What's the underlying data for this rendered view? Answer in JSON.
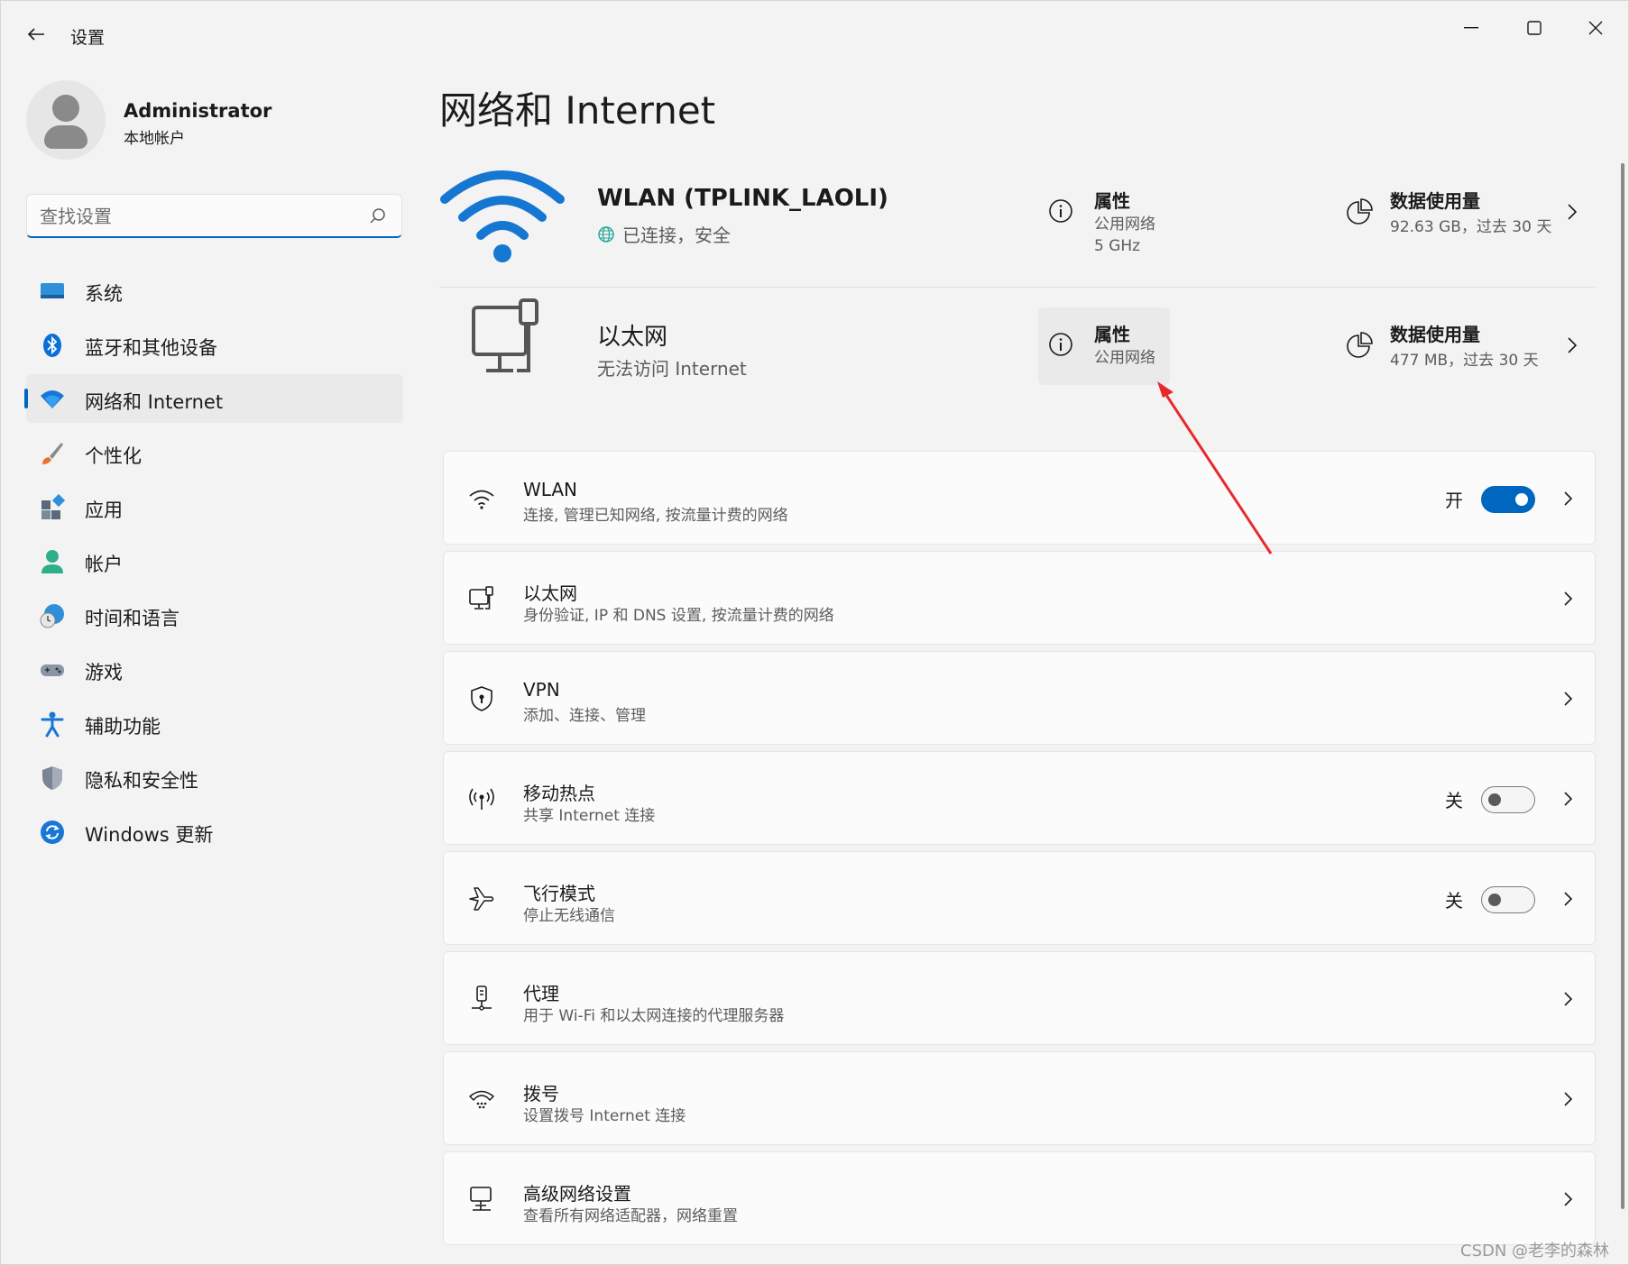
{
  "window": {
    "title": "设置"
  },
  "profile": {
    "name": "Administrator",
    "account_type": "本地帐户"
  },
  "search": {
    "placeholder": "查找设置"
  },
  "nav": [
    {
      "label": "系统",
      "icon": "display-icon"
    },
    {
      "label": "蓝牙和其他设备",
      "icon": "bluetooth-icon"
    },
    {
      "label": "网络和 Internet",
      "icon": "wifi-icon",
      "active": true
    },
    {
      "label": "个性化",
      "icon": "brush-icon"
    },
    {
      "label": "应用",
      "icon": "apps-icon"
    },
    {
      "label": "帐户",
      "icon": "person-icon"
    },
    {
      "label": "时间和语言",
      "icon": "clock-globe-icon"
    },
    {
      "label": "游戏",
      "icon": "gamepad-icon"
    },
    {
      "label": "辅助功能",
      "icon": "accessibility-icon"
    },
    {
      "label": "隐私和安全性",
      "icon": "shield-icon"
    },
    {
      "label": "Windows 更新",
      "icon": "update-icon"
    }
  ],
  "page": {
    "title": "网络和 Internet"
  },
  "connections": [
    {
      "name": "WLAN (TPLINK_LAOLI)",
      "status": "已连接，安全",
      "properties_title": "属性",
      "properties_network": "公用网络",
      "properties_band": "5 GHz",
      "usage_title": "数据使用量",
      "usage_value": "92.63 GB，过去 30 天"
    },
    {
      "name": "以太网",
      "status": "无法访问 Internet",
      "properties_title": "属性",
      "properties_network": "公用网络",
      "usage_title": "数据使用量",
      "usage_value": "477 MB，过去 30 天"
    }
  ],
  "cards": [
    {
      "title": "WLAN",
      "subtitle": "连接, 管理已知网络, 按流量计费的网络",
      "icon": "wifi-icon",
      "toggle_label": "开",
      "toggle_on": true
    },
    {
      "title": "以太网",
      "subtitle": "身份验证, IP 和 DNS 设置, 按流量计费的网络",
      "icon": "ethernet-icon"
    },
    {
      "title": "VPN",
      "subtitle": "添加、连接、管理",
      "icon": "vpn-shield-icon"
    },
    {
      "title": "移动热点",
      "subtitle": "共享 Internet 连接",
      "icon": "hotspot-icon",
      "toggle_label": "关",
      "toggle_on": false
    },
    {
      "title": "飞行模式",
      "subtitle": "停止无线通信",
      "icon": "airplane-icon",
      "toggle_label": "关",
      "toggle_on": false
    },
    {
      "title": "代理",
      "subtitle": "用于 Wi-Fi 和以太网连接的代理服务器",
      "icon": "proxy-icon"
    },
    {
      "title": "拨号",
      "subtitle": "设置拨号 Internet 连接",
      "icon": "dialup-icon"
    },
    {
      "title": "高级网络设置",
      "subtitle": "查看所有网络适配器，网络重置",
      "icon": "advanced-network-icon"
    }
  ],
  "watermark": "CSDN @老李的森林",
  "colors": {
    "accent": "#0067c0",
    "annotation_arrow": "#e8292c"
  }
}
